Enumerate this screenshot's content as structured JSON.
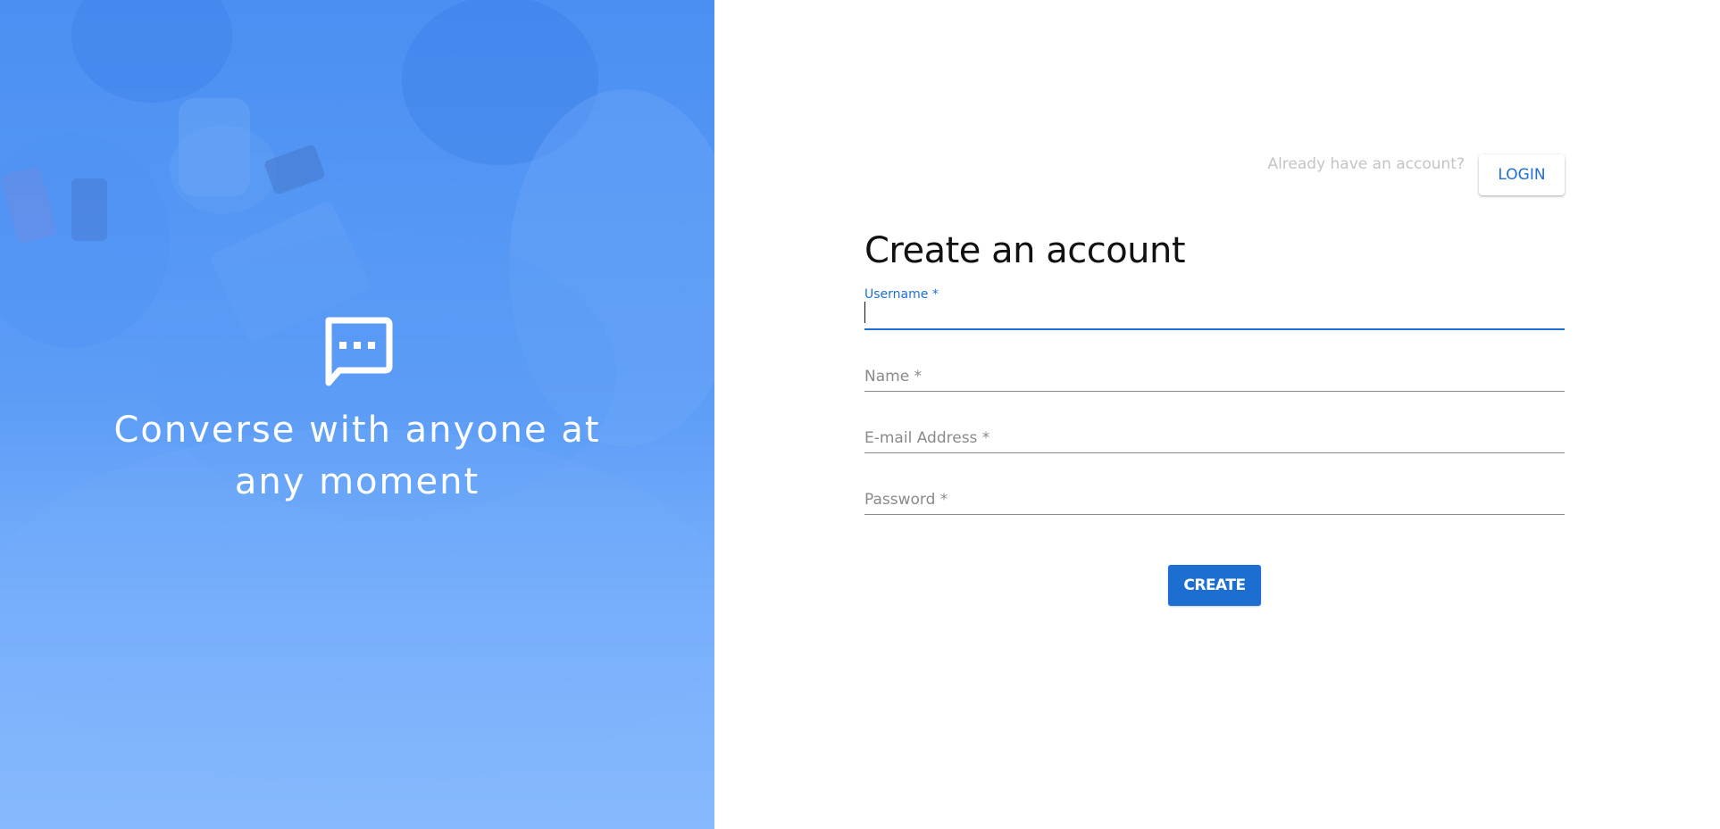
{
  "hero": {
    "icon": "chat-bubble-icon",
    "tagline": "Converse with anyone at any moment"
  },
  "header": {
    "prompt": "Already have an account?",
    "login_label": "LOGIN"
  },
  "form": {
    "title": "Create an account",
    "fields": [
      {
        "label": "Username *",
        "value": "",
        "active": true
      },
      {
        "label": "Name *",
        "value": "",
        "active": false
      },
      {
        "label": "E-mail Address *",
        "value": "",
        "active": false
      },
      {
        "label": "Password *",
        "value": "",
        "active": false
      }
    ],
    "submit_label": "CREATE"
  },
  "colors": {
    "accent": "#1e6fd9",
    "hero_blue": "#5c9cf6",
    "button_blue": "#1c6fd0"
  }
}
